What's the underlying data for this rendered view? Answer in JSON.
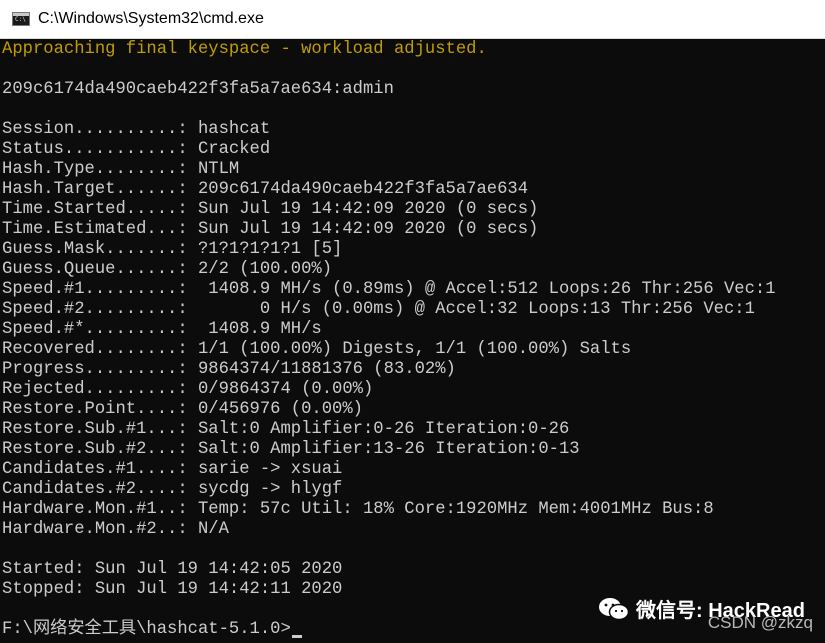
{
  "window": {
    "title": "C:\\Windows\\System32\\cmd.exe"
  },
  "console": {
    "lines": [
      "Approaching final keyspace - workload adjusted.",
      "",
      "209c6174da490caeb422f3fa5a7ae634:admin",
      "",
      "Session..........: hashcat",
      "Status...........: Cracked",
      "Hash.Type........: NTLM",
      "Hash.Target......: 209c6174da490caeb422f3fa5a7ae634",
      "Time.Started.....: Sun Jul 19 14:42:09 2020 (0 secs)",
      "Time.Estimated...: Sun Jul 19 14:42:09 2020 (0 secs)",
      "Guess.Mask.......: ?1?1?1?1?1 [5]",
      "Guess.Queue......: 2/2 (100.00%)",
      "Speed.#1.........:  1408.9 MH/s (0.89ms) @ Accel:512 Loops:26 Thr:256 Vec:1",
      "Speed.#2.........:       0 H/s (0.00ms) @ Accel:32 Loops:13 Thr:256 Vec:1",
      "Speed.#*.........:  1408.9 MH/s",
      "Recovered........: 1/1 (100.00%) Digests, 1/1 (100.00%) Salts",
      "Progress.........: 9864374/11881376 (83.02%)",
      "Rejected.........: 0/9864374 (0.00%)",
      "Restore.Point....: 0/456976 (0.00%)",
      "Restore.Sub.#1...: Salt:0 Amplifier:0-26 Iteration:0-26",
      "Restore.Sub.#2...: Salt:0 Amplifier:13-26 Iteration:0-13",
      "Candidates.#1....: sarie -> xsuai",
      "Candidates.#2....: sycdg -> hlygf",
      "Hardware.Mon.#1..: Temp: 57c Util: 18% Core:1920MHz Mem:4001MHz Bus:8",
      "Hardware.Mon.#2..: N/A",
      "",
      "Started: Sun Jul 19 14:42:05 2020",
      "Stopped: Sun Jul 19 14:42:11 2020",
      ""
    ],
    "prompt": "F:\\网络安全工具\\hashcat-5.1.0>"
  },
  "watermark": {
    "icon": "wechat-icon",
    "text": "微信号: HackRead"
  },
  "credit": "CSDN @zkzq",
  "colors": {
    "background": "#0c0c0c",
    "text": "#cccccc",
    "warning": "#c19c00"
  }
}
